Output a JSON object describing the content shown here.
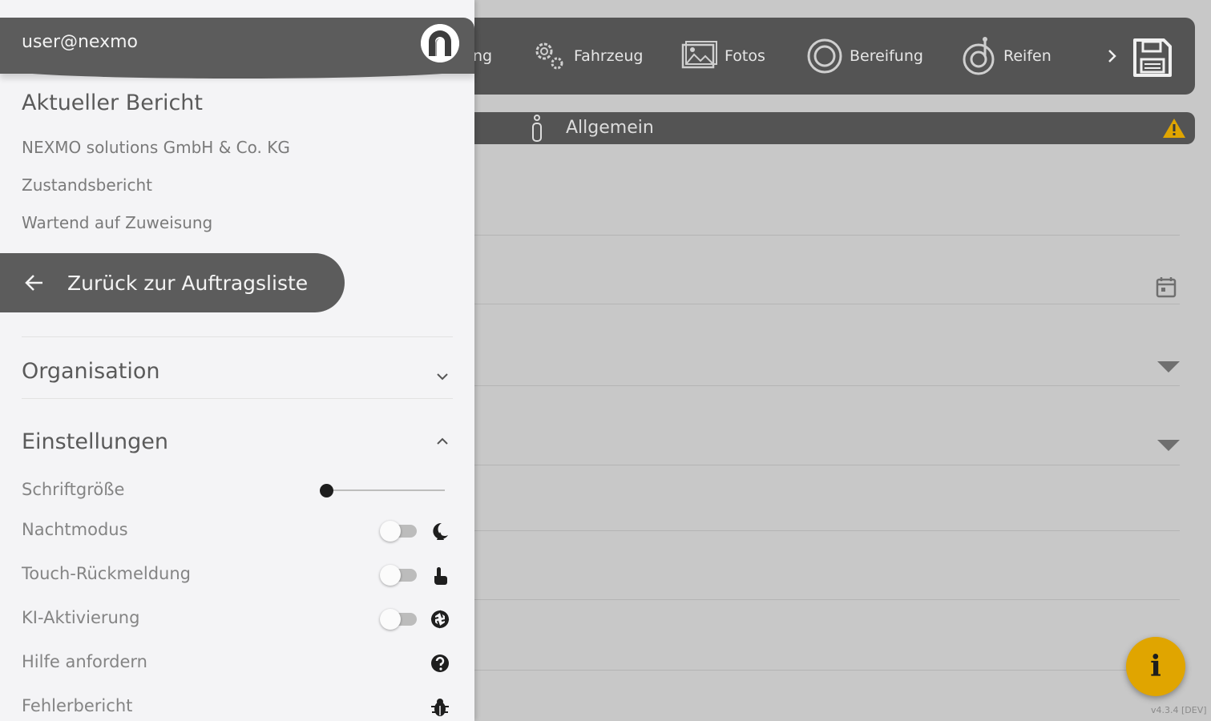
{
  "topnav": {
    "partial_label": "ng",
    "tabs": [
      {
        "label": "Fahrzeug",
        "icon": "gears-icon"
      },
      {
        "label": "Fotos",
        "icon": "photos-icon"
      },
      {
        "label": "Bereifung",
        "icon": "tire-icon"
      },
      {
        "label": "Reifen",
        "icon": "tire-gauge-icon"
      }
    ],
    "next_icon": "chevron-right-icon",
    "save_icon": "save-icon"
  },
  "section": {
    "title": "Allgemein",
    "icon": "info-icon",
    "warning_icon": "warning-icon"
  },
  "fab": {
    "label": "i"
  },
  "version": "v4.3.4 [DEV]",
  "drawer": {
    "user": "user@nexmo",
    "report": {
      "title": "Aktueller Bericht",
      "company": "NEXMO solutions GmbH & Co. KG",
      "type": "Zustandsbericht",
      "status": "Wartend auf Zuweisung"
    },
    "back_label": "Zurück zur Auftragsliste",
    "organisation": "Organisation",
    "settings": {
      "title": "Einstellungen",
      "font_size": {
        "label": "Schriftgröße",
        "value": 0
      },
      "night_mode": {
        "label": "Nachtmodus",
        "on": false
      },
      "touch_feedback": {
        "label": "Touch-Rückmeldung",
        "on": false
      },
      "ai_activation": {
        "label": "KI-Aktivierung",
        "on": false
      },
      "help": {
        "label": "Hilfe anfordern"
      },
      "bug_report": {
        "label": "Fehlerbericht"
      }
    }
  },
  "colors": {
    "accent": "#e0a500",
    "bar": "#545454",
    "drawer_bg": "#f4f4f6"
  }
}
